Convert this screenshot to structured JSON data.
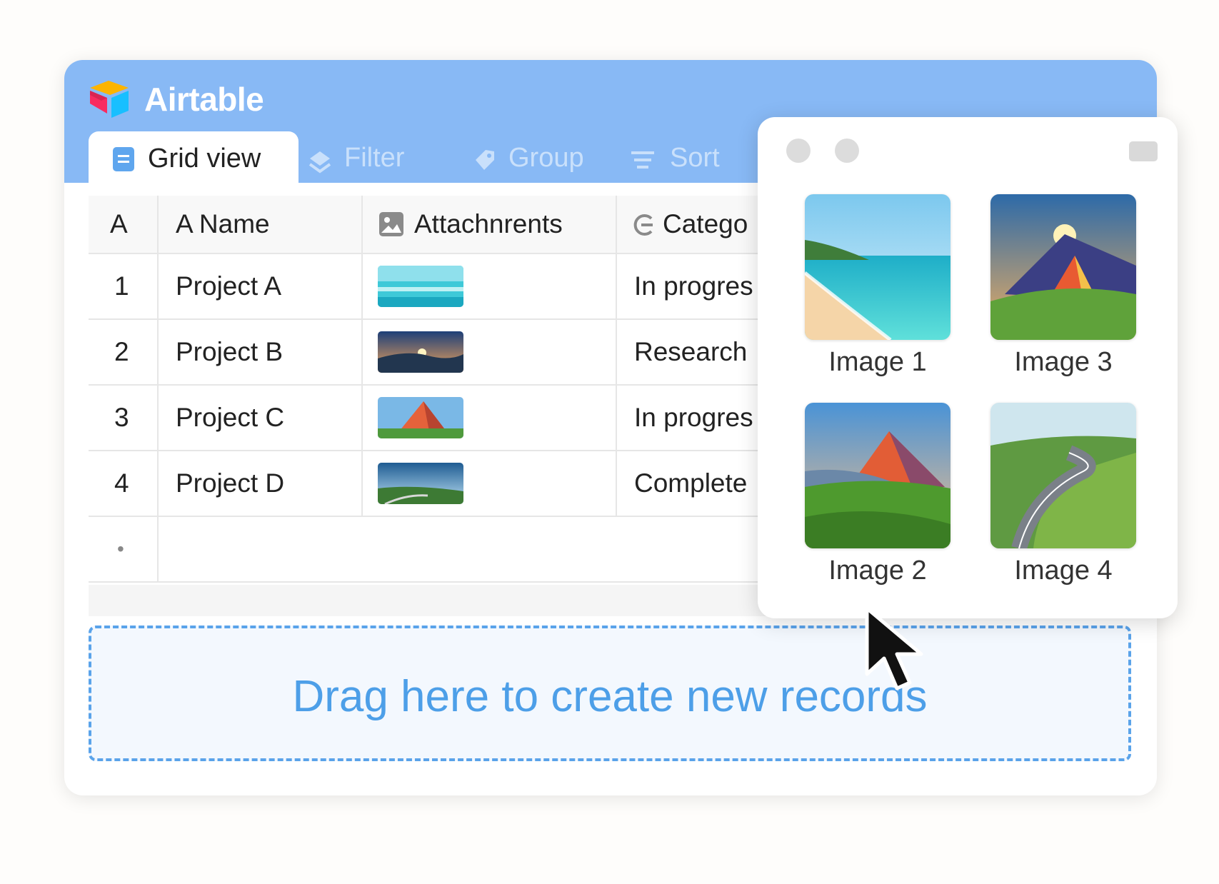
{
  "app": {
    "title": "Airtable"
  },
  "toolbar": {
    "active_view": "Grid view",
    "filter_label": "Filter",
    "group_label": "Group",
    "sort_label": "Sort"
  },
  "table": {
    "columns": [
      "A",
      "A  Name",
      "Attachnrents",
      "Catego"
    ],
    "rows": [
      {
        "num": "1",
        "name": "Project A",
        "category": "In progres",
        "thumb": "beach"
      },
      {
        "num": "2",
        "name": "Project B",
        "category": "Research",
        "thumb": "sunrise"
      },
      {
        "num": "3",
        "name": "Project C",
        "category": "In progres",
        "thumb": "tent"
      },
      {
        "num": "4",
        "name": "Project D",
        "category": "Complete",
        "thumb": "valley"
      }
    ],
    "add_row_marker": "•"
  },
  "dropzone": {
    "label": "Drag here to create new records"
  },
  "popup": {
    "images": [
      {
        "caption": "Image 1",
        "scene": "beach"
      },
      {
        "caption": "Image 3",
        "scene": "tent-sunset"
      },
      {
        "caption": "Image 2",
        "scene": "mountain"
      },
      {
        "caption": "Image 4",
        "scene": "road"
      }
    ]
  },
  "colors": {
    "header": "#88b9f5",
    "dropzone_accent": "#4d9fe8",
    "toolbar_inactive": "#c9e0fb"
  }
}
